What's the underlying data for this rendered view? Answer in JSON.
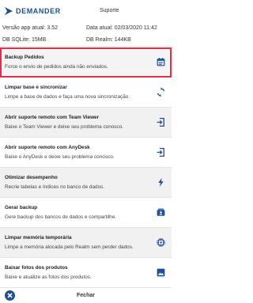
{
  "header": {
    "brand": "DEMANDER",
    "title": "Suporte"
  },
  "info": {
    "version": "Versão app atual: 3.52",
    "date": "Data atual: 02/03/2020 11:42",
    "sqlite": "DB SQLite: 15MB",
    "realm": "DB Realm: 144KB"
  },
  "menu": [
    {
      "title": "Backup Pedidos",
      "desc": "Force o envio de pedidos ainda não enviados.",
      "icon": "calendar-icon",
      "selected": true
    },
    {
      "title": "Limpar base e sincronizar",
      "desc": "Limpe a base de dados e faça uma nova sincronização.",
      "icon": "sync-icon"
    },
    {
      "title": "Abrir suporte remoto com Team Viewer",
      "desc": "Baixe o Team Viewer e deixe seu problema conosco.",
      "icon": "open-in-icon"
    },
    {
      "title": "Abrir suporte remoto com AnyDesk",
      "desc": "Baixe o AnyDesk e deixe seu problema conosco.",
      "icon": "open-in-icon"
    },
    {
      "title": "Otimizar desempenho",
      "desc": "Recrie tabelas e índices no banco de dados.",
      "icon": "bolt-icon"
    },
    {
      "title": "Gerar backup",
      "desc": "Gere backup dos bancos de dados e compartilhe.",
      "icon": "share-icon"
    },
    {
      "title": "Limpar memória temporária",
      "desc": "Limpe a memória alocada pelo Realm sem perder dados.",
      "icon": "memory-icon"
    },
    {
      "title": "Baixar fotos dos produtos",
      "desc": "Baixe e atualize as fotos dos produtos.",
      "icon": "image-icon"
    }
  ],
  "footer": {
    "close_label": "Fechar"
  },
  "colors": {
    "brand": "#1d4f8c",
    "icon": "#1f4f9a",
    "selected_border": "#e0304a",
    "alt_row": "#f1f1f1"
  }
}
